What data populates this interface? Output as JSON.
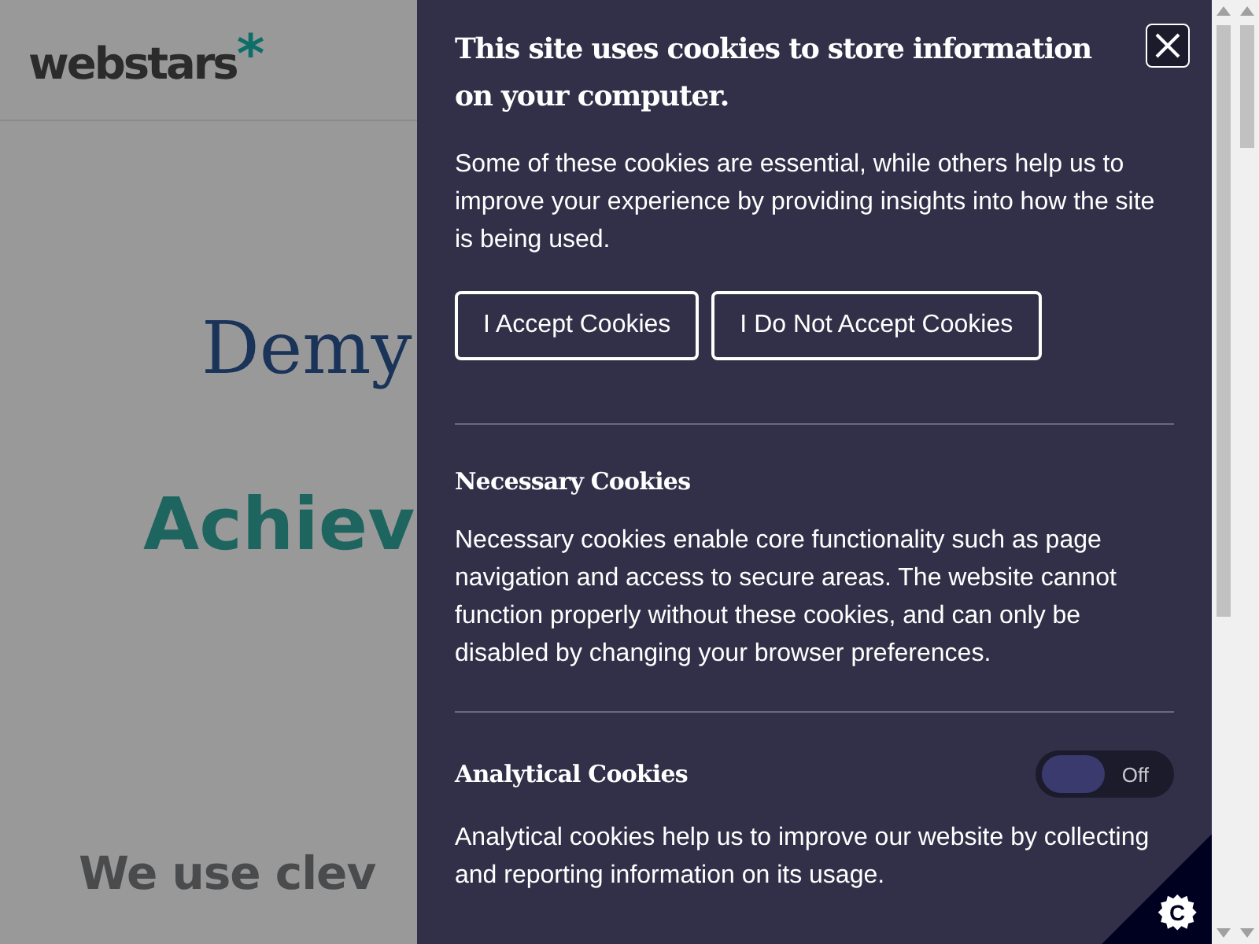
{
  "page": {
    "logo": {
      "word": "webstars",
      "mark": "*"
    },
    "headline_1": "Demy",
    "headline_2": "Achiev",
    "subheading": "We use clev"
  },
  "cookie_panel": {
    "title": "This site uses cookies to store information on your computer.",
    "intro": "Some of these cookies are essential, while others help us to improve your experience by providing insights into how the site is being used.",
    "buttons": [
      "I Accept Cookies",
      "I Do Not Accept Cookies"
    ],
    "sections": [
      {
        "title": "Necessary Cookies",
        "text": "Necessary cookies enable core functionality such as page navigation and access to secure areas. The website cannot function properly without these cookies, and can only be disabled by changing your browser preferences."
      },
      {
        "title": "Analytical Cookies",
        "toggle": {
          "on": false,
          "label": "Off"
        },
        "text": "Analytical cookies help us to improve our website by collecting and reporting information on its usage."
      }
    ]
  },
  "badge": {
    "letter": "C"
  }
}
